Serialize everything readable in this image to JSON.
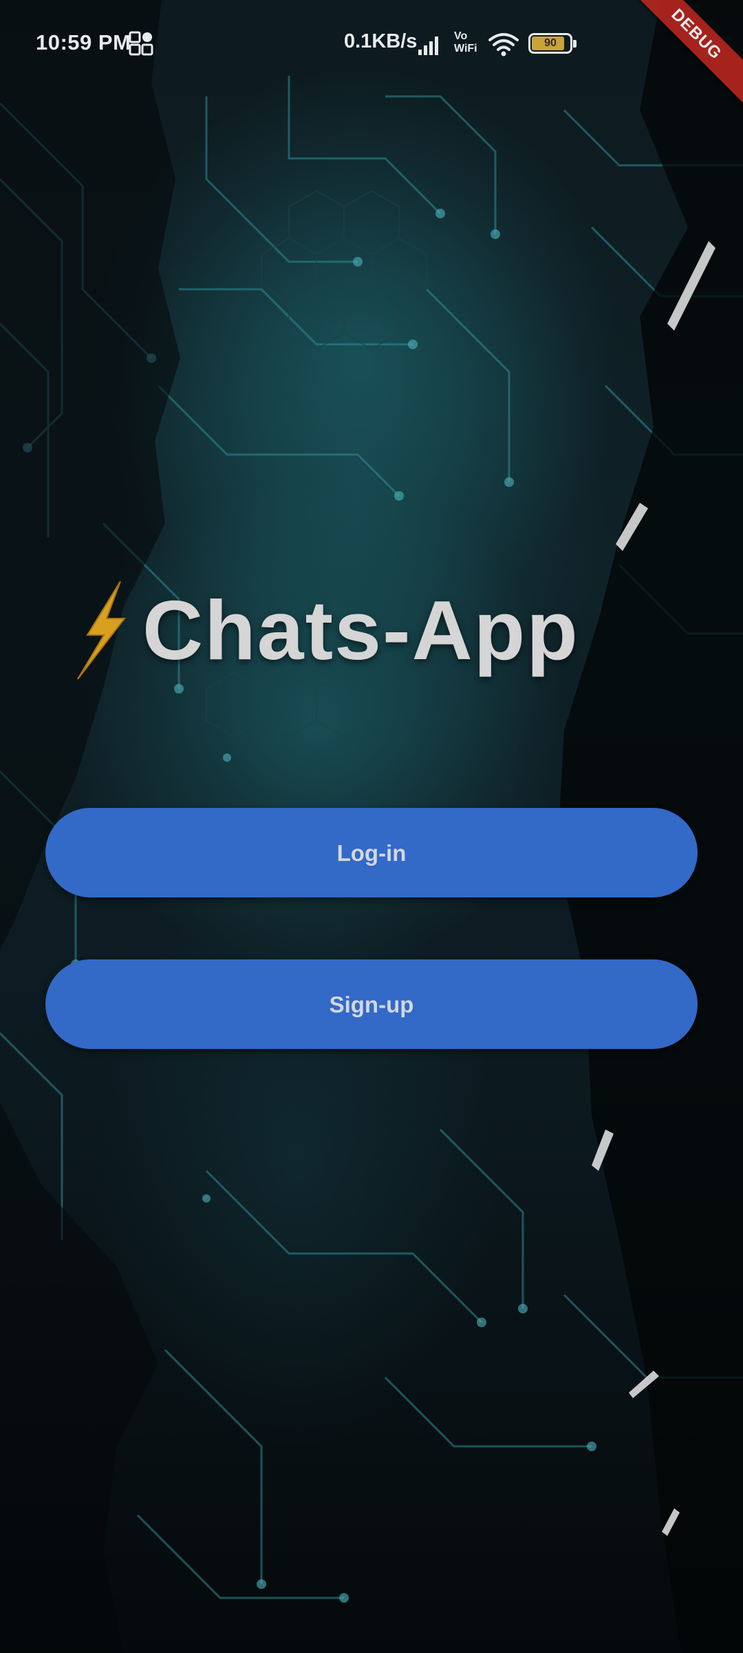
{
  "status_bar": {
    "time": "10:59 PM",
    "network_speed": "0.1KB/s",
    "vowifi_label": "Vo\nWiFi",
    "battery_level": "90",
    "icons": [
      "app-grid-icon",
      "signal-icon",
      "wifi-icon",
      "battery-icon"
    ]
  },
  "debug_banner": {
    "label": "DEBUG"
  },
  "header": {
    "icon": "lightning-bolt-icon",
    "title": "Chats-App"
  },
  "actions": {
    "login_label": "Log-in",
    "signup_label": "Sign-up"
  },
  "colors": {
    "button_background": "#3369c7",
    "button_text": "#d3d7de",
    "title_text": "#d5d5d5",
    "bolt": "#d9a020",
    "debug_banner": "#b3261e"
  }
}
